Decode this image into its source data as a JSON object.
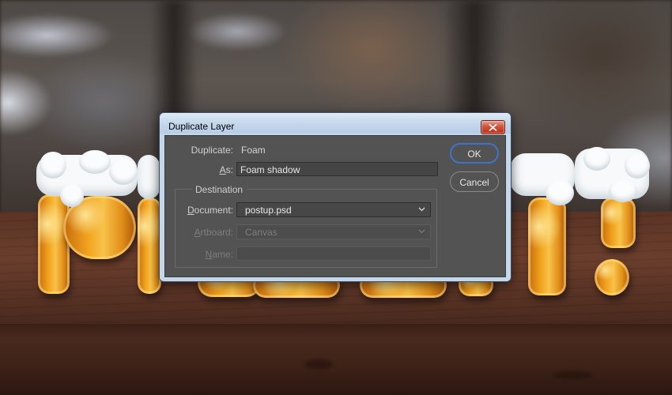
{
  "dialog": {
    "title": "Duplicate Layer",
    "duplicate_label": "Duplicate:",
    "duplicate_value": "Foam",
    "as_label_letter": "A",
    "as_label_rest": "s:",
    "as_value": "Foam shadow",
    "destination_label": "Destination",
    "document_label_letter": "D",
    "document_label_rest": "ocument:",
    "document_value": "postup.psd",
    "artboard_label_letter": "A",
    "artboard_label_rest": "rtboard:",
    "artboard_value": "Canvas",
    "name_label_letter": "N",
    "name_label_rest": "ame:",
    "name_value": "",
    "ok_label": "OK",
    "cancel_label": "Cancel"
  },
  "icons": {
    "close": "close-icon",
    "dropdown": "chevron-down-icon"
  },
  "colors": {
    "dialog_body": "#535353",
    "titlebar": "#c5d7ea",
    "close_button": "#c8442c",
    "ok_border": "#3d74c9",
    "beer": "#f2a51f",
    "foam": "#f7f9fa"
  }
}
